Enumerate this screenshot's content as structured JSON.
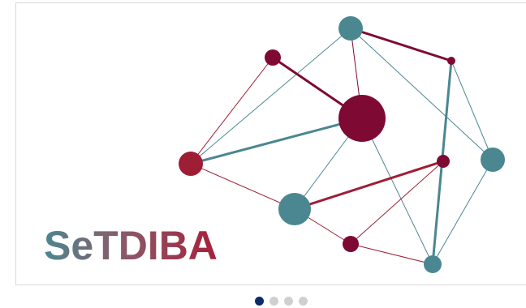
{
  "slider": {
    "logo_text": "SeTDIBA",
    "slide_count": 4,
    "active_index": 0
  },
  "colors": {
    "teal": "#4b8790",
    "crimson": "#7e0a33",
    "red": "#9e1e35",
    "dot_active": "#0d2b6b",
    "dot_inactive": "#cfcfcf"
  }
}
